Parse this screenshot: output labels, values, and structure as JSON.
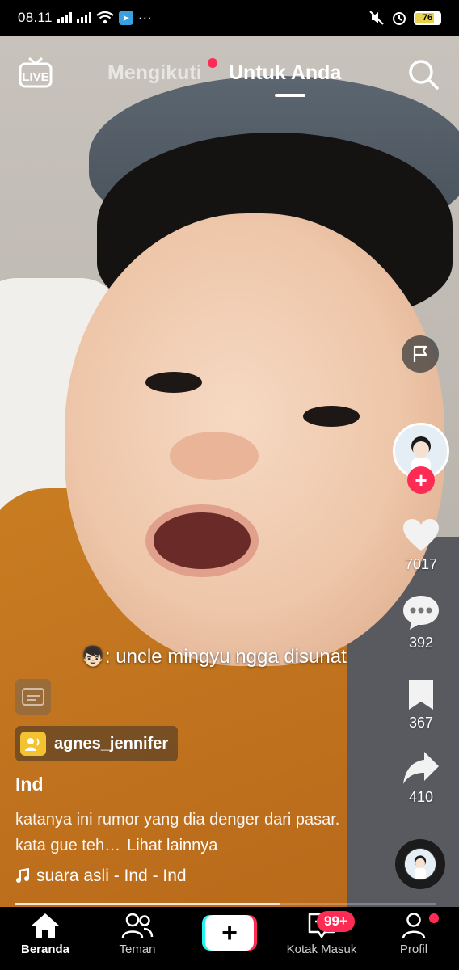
{
  "status_bar": {
    "time": "08.11",
    "more": "···",
    "battery": "76"
  },
  "top_nav": {
    "live_label": "LIVE",
    "tab_following": "Mengikuti",
    "tab_for_you": "Untuk Anda",
    "active_tab": "Untuk Anda"
  },
  "video": {
    "sticker_text": "uncle mingyu ngga disunat",
    "sticker_emoji": "👦🏻:",
    "mention_user": "agnes_jennifer",
    "author": "Ind",
    "description": "katanya ini rumor yang dia denger dari pasar. kata gue teh…",
    "see_more": "Lihat lainnya",
    "music": "suara asli - Ind - Ind",
    "progress_fraction": 0.63
  },
  "rail": {
    "likes": "7017",
    "comments": "392",
    "saves": "367",
    "shares": "410"
  },
  "bottom_nav": {
    "home": "Beranda",
    "friends": "Teman",
    "create": "+",
    "inbox": "Kotak Masuk",
    "inbox_badge": "99+",
    "profile": "Profil",
    "active": "Beranda"
  },
  "colors": {
    "accent_red": "#fe2c55",
    "accent_cyan": "#25f4ee"
  }
}
